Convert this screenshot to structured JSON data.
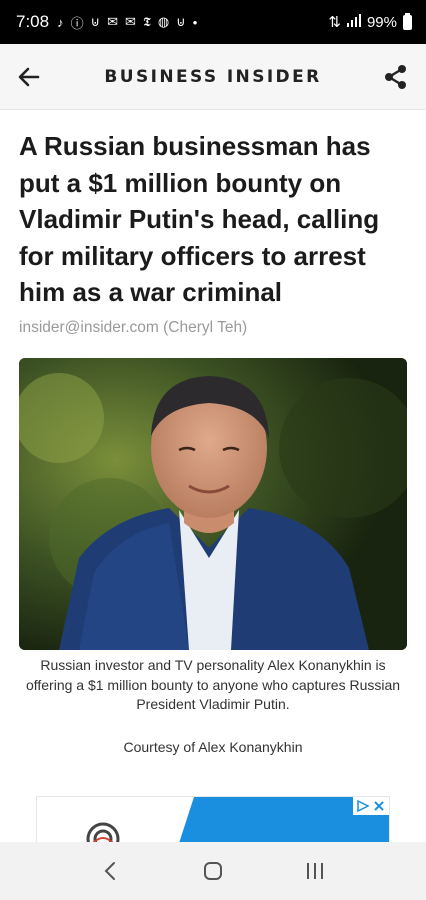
{
  "status_bar": {
    "time": "7:08",
    "battery_text": "99%",
    "icons": [
      "tiktok-icon",
      "info-icon",
      "ink-icon",
      "mail-icon",
      "gmail-icon",
      "nyt-icon",
      "assistant-icon",
      "ink-icon",
      "dot-icon",
      "wifi-icon",
      "signal-icon",
      "battery-icon"
    ]
  },
  "app_header": {
    "brand": "BUSINESS INSIDER",
    "back_icon": "back-arrow-icon",
    "share_icon": "share-icon"
  },
  "article": {
    "headline": "A Russian businessman has put a $1 million bounty on Vladimir Putin's head, calling for military officers to arrest him as a war criminal",
    "byline": "insider@insider.com (Cheryl Teh)",
    "image_caption": "Russian investor and TV personality Alex Konanykhin is offering a $1 million bounty to anyone who captures Russian President Vladimir Putin.",
    "image_credit": "Courtesy of Alex Konanykhin"
  },
  "ad": {
    "adchoices_icon": "adchoices-icon",
    "close_icon": "close-icon",
    "accent": "#1a8fe0"
  },
  "nav_bar": {
    "back_icon": "nav-back-icon",
    "home_icon": "nav-home-icon",
    "recents_icon": "nav-recents-icon"
  }
}
